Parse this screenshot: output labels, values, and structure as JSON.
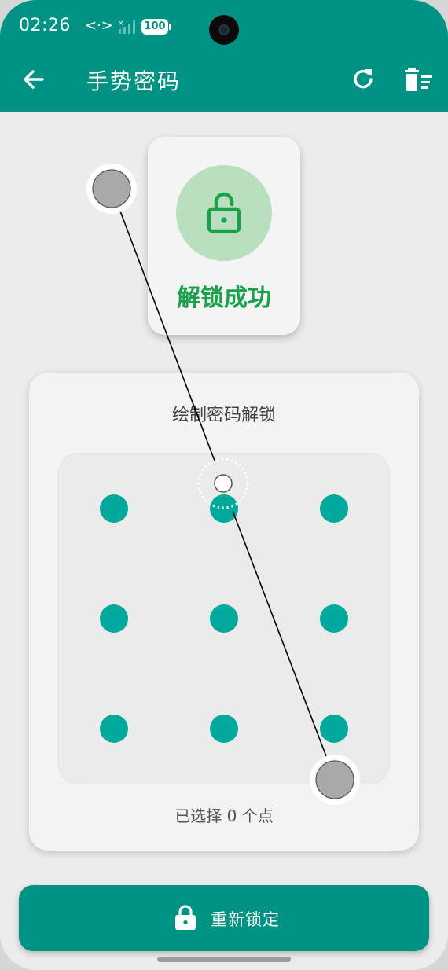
{
  "status_bar": {
    "time": "02:26",
    "network_icon": "<·>",
    "battery": "100"
  },
  "app_bar": {
    "title": "手势密码",
    "back_icon": "arrow-left-icon",
    "refresh_icon": "refresh-icon",
    "delete_icon": "delete-sweep-icon"
  },
  "success": {
    "text": "解锁成功",
    "icon": "lock-open-icon"
  },
  "pattern": {
    "prompt": "绘制密码解锁",
    "status": "已选择 0 个点"
  },
  "relock": {
    "label": "重新锁定",
    "icon": "lock-icon"
  },
  "colors": {
    "primary": "#009282",
    "dot": "#00a99b",
    "success": "#1aa24b",
    "success_bg": "#b9dfbf"
  }
}
